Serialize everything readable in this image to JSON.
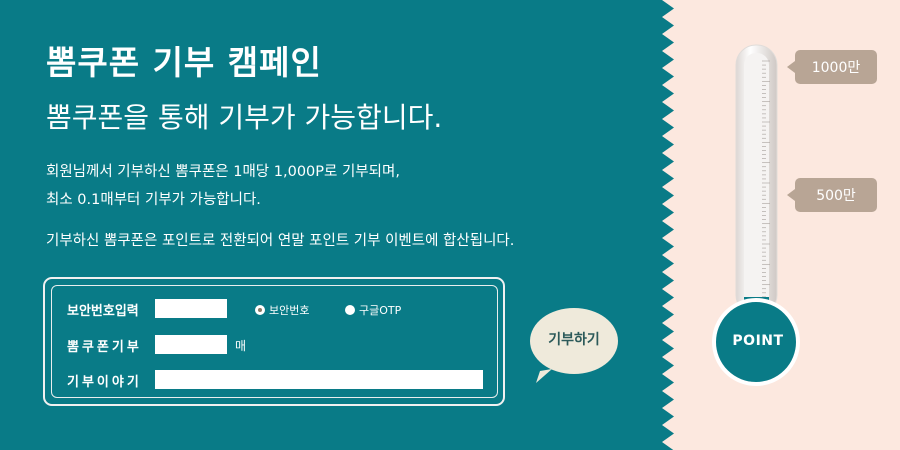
{
  "campaign": {
    "title": "뽐쿠폰 기부 캠페인",
    "subtitle": "뽐쿠폰을 통해 기부가 가능합니다.",
    "desc_line1": "회원님께서 기부하신 뽐쿠폰은 1매당 1,000P로 기부되며,",
    "desc_line2": "최소 0.1매부터 기부가 가능합니다.",
    "desc_line3": "기부하신 뽐쿠폰은 포인트로 전환되어 연말 포인트 기부 이벤트에 합산됩니다."
  },
  "form": {
    "security_label": "보안번호입력",
    "security_value": "",
    "radio_security_label": "보안번호",
    "radio_otp_label": "구글OTP",
    "radio_selected": "보안번호",
    "coupon_label": "뽐쿠폰기부",
    "coupon_value": "",
    "coupon_unit": "매",
    "story_label": "기부이야기",
    "story_value": "",
    "submit_label": "기부하기"
  },
  "thermometer": {
    "top_tag": "1000만",
    "mid_tag": "500만",
    "bulb_label": "POINT",
    "fill_fraction": 0
  },
  "colors": {
    "teal": "#097b87",
    "peach": "#fce8df",
    "tag": "#b8a595",
    "bubble": "#efeadb"
  }
}
